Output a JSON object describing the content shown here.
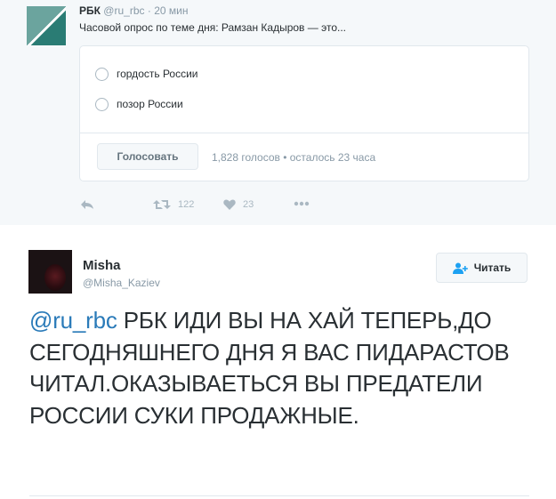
{
  "tweet1": {
    "author_name": "РБК",
    "handle": "@ru_rbc",
    "separator": "·",
    "time": "20 мин",
    "text": "Часовой опрос по теме дня: Рамзан Кадыров — это...",
    "avatar_icon": "rbc-logo-icon",
    "poll": {
      "options": [
        "гордость России",
        "позор России"
      ],
      "vote_button": "Голосовать",
      "stats": "1,828 голосов • осталось 23 часа"
    },
    "actions": {
      "reply_icon": "reply-icon",
      "retweet_icon": "retweet-icon",
      "retweet_count": "122",
      "like_icon": "heart-icon",
      "like_count": "23",
      "more_icon": "more-dots-icon"
    }
  },
  "tweet2": {
    "author_name": "Misha",
    "handle": "@Misha_Kaziev",
    "follow_button": "Читать",
    "follow_icon": "add-user-icon",
    "mention": "@ru_rbc",
    "text": " РБК ИДИ ВЫ НА ХАЙ ТЕПЕРЬ,ДО СЕГОДНЯШНЕГО ДНЯ Я ВАС ПИДАРАСТОВ ЧИТАЛ.ОКАЗЫВАЕТЬСЯ ВЫ ПРЕДАТЕЛИ РОССИИ СУКИ ПРОДАЖНЫЕ."
  },
  "colors": {
    "link": "#2b7bb9",
    "muted": "#8899a6",
    "text": "#292f33",
    "card_bg": "#f5f8fa",
    "rbc_brand": "#2a7c74"
  }
}
